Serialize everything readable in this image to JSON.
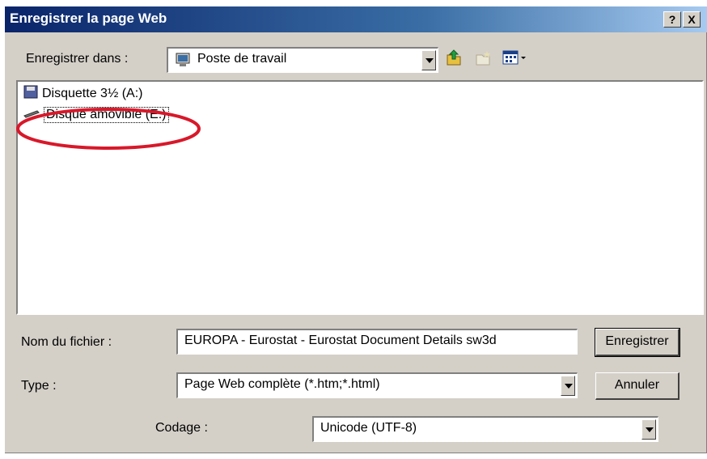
{
  "window": {
    "title": "Enregistrer la page Web",
    "help": "?",
    "close": "X"
  },
  "save_in": {
    "label": "Enregistrer dans :",
    "value": "Poste de travail"
  },
  "files": [
    {
      "label": "Disquette 3½ (A:)",
      "icon": "floppy-drive-icon"
    },
    {
      "label": "Disque amovible (E:)",
      "icon": "removable-drive-icon"
    }
  ],
  "filename": {
    "label": "Nom du fichier :",
    "value": "EUROPA - Eurostat - Eurostat Document Details sw3d"
  },
  "type": {
    "label": "Type :",
    "value": "Page Web complète (*.htm;*.html)"
  },
  "encoding": {
    "label": "Codage :",
    "value": "Unicode (UTF-8)"
  },
  "buttons": {
    "save": "Enregistrer",
    "cancel": "Annuler"
  },
  "colors": {
    "highlight_circle": "#d8182a",
    "titlebar": "#0a246a"
  }
}
